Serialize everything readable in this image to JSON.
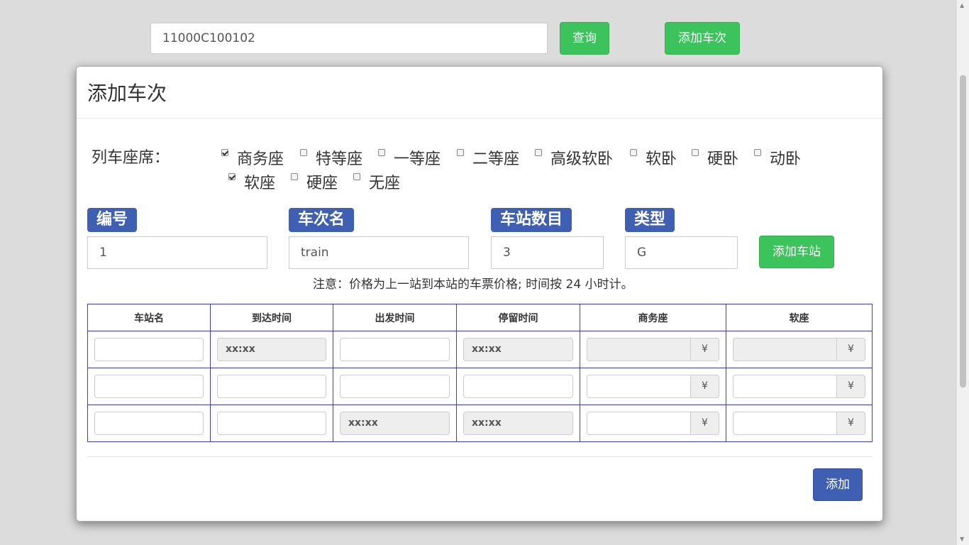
{
  "search": {
    "value": "11000C100102"
  },
  "toolbar": {
    "query_label": "查询",
    "add_train_label": "添加车次"
  },
  "modal": {
    "title": "添加车次",
    "seat_label": "列车座席：",
    "seats": [
      {
        "label": "商务座",
        "checked": true
      },
      {
        "label": "特等座",
        "checked": false
      },
      {
        "label": "一等座",
        "checked": false
      },
      {
        "label": "二等座",
        "checked": false
      },
      {
        "label": "高级软卧",
        "checked": false
      },
      {
        "label": "软卧",
        "checked": false
      },
      {
        "label": "硬卧",
        "checked": false
      },
      {
        "label": "动卧",
        "checked": false
      },
      {
        "label": "软座",
        "checked": true
      },
      {
        "label": "硬座",
        "checked": false
      },
      {
        "label": "无座",
        "checked": false
      }
    ],
    "fields": {
      "id": {
        "label": "编号",
        "value": "1"
      },
      "name": {
        "label": "车次名",
        "value": "train"
      },
      "station_count": {
        "label": "车站数目",
        "value": "3"
      },
      "type": {
        "label": "类型",
        "value": "G"
      }
    },
    "add_station_label": "添加车站",
    "note": "注意：价格为上一站到本站的车票价格; 时间按 24 小时计。",
    "table": {
      "headers": [
        "车站名",
        "到达时间",
        "出发时间",
        "停留时间",
        "商务座",
        "软座"
      ],
      "currency": "¥",
      "placeholder_time": "xx:xx"
    },
    "submit_label": "添加"
  }
}
